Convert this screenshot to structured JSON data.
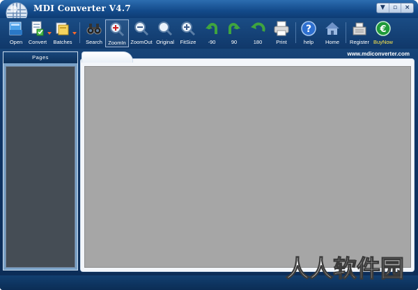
{
  "window": {
    "title": "MDI Converter V4.7",
    "controls": {
      "minimize": "▼",
      "restore": "▫",
      "close": "×"
    }
  },
  "toolbar": {
    "buttons": [
      {
        "id": "open",
        "label": "Open",
        "icon": "folder-open-icon"
      },
      {
        "id": "convert",
        "label": "Convert",
        "icon": "convert-document-icon"
      },
      {
        "id": "batches",
        "label": "Batches",
        "icon": "batch-folder-icon"
      },
      {
        "id": "search",
        "label": "Search",
        "icon": "binoculars-icon"
      },
      {
        "id": "zoomin",
        "label": "ZoomIn",
        "icon": "zoom-in-icon"
      },
      {
        "id": "zoomout",
        "label": "ZoomOut",
        "icon": "zoom-out-icon"
      },
      {
        "id": "original",
        "label": "Original",
        "icon": "magnifier-icon"
      },
      {
        "id": "fitsize",
        "label": "FitSize",
        "icon": "fit-size-icon"
      },
      {
        "id": "rotate-left",
        "label": "-90",
        "icon": "rotate-left-icon"
      },
      {
        "id": "rotate-right",
        "label": "90",
        "icon": "rotate-right-icon"
      },
      {
        "id": "rotate-180",
        "label": "180",
        "icon": "rotate-180-icon"
      },
      {
        "id": "print",
        "label": "Print",
        "icon": "printer-icon"
      },
      {
        "id": "help",
        "label": "help",
        "icon": "help-icon"
      },
      {
        "id": "home",
        "label": "Home",
        "icon": "home-icon"
      },
      {
        "id": "register",
        "label": "Register",
        "icon": "cash-register-icon"
      },
      {
        "id": "buynow",
        "label": "BuyNow",
        "icon": "euro-coin-icon"
      }
    ]
  },
  "left_panel": {
    "header": "Pages"
  },
  "viewer": {
    "site_link": "www.mdiconverter.com"
  },
  "watermark": {
    "text": "人人软件园"
  },
  "colors": {
    "accent": "#134a8a",
    "canvas": "#a6a6a6",
    "buy_label": "#ffe84a"
  }
}
